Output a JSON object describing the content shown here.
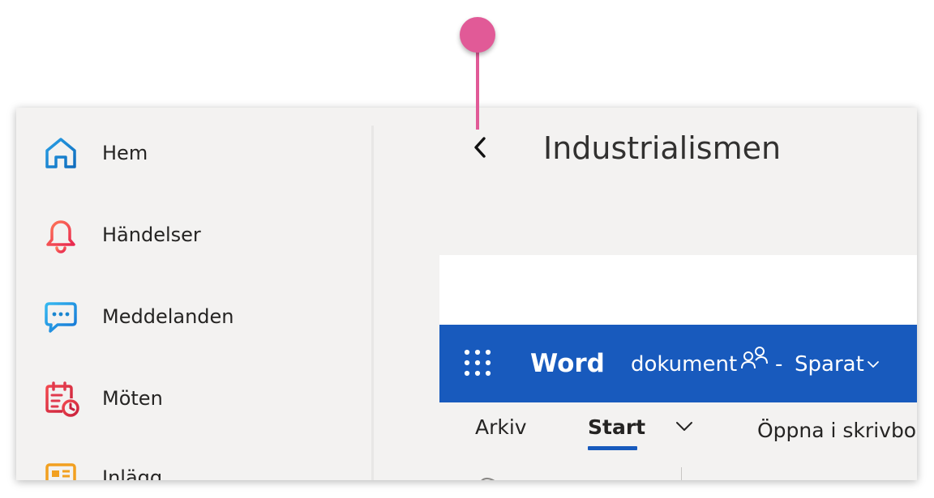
{
  "sidebar": {
    "items": [
      {
        "label": "Hem",
        "icon": "home-icon",
        "color": "#1a86d0"
      },
      {
        "label": "Händelser",
        "icon": "bell-icon",
        "color": "#f2484e"
      },
      {
        "label": "Meddelanden",
        "icon": "chat-icon",
        "color": "#1c9be6"
      },
      {
        "label": "Möten",
        "icon": "calendar-clock-icon",
        "color": "#e03a4e"
      },
      {
        "label": "Inlägg",
        "icon": "news-icon",
        "color": "#f2a020"
      }
    ]
  },
  "header": {
    "back_icon": "chevron-left-icon",
    "title": "Industrialismen"
  },
  "word": {
    "bar_color": "#185abd",
    "app_name": "Word",
    "doc_name": "dokument",
    "share_icon": "people-icon",
    "separator": "-",
    "save_status": "Sparat",
    "save_chevron_icon": "chevron-down-icon"
  },
  "ribbon": {
    "tabs": [
      {
        "label": "Arkiv",
        "active": false
      },
      {
        "label": "Start",
        "active": true
      },
      {
        "label": "Öppna i skrivbo",
        "active": false
      }
    ],
    "more_icon": "chevron-down-icon"
  },
  "annotation": {
    "marker_color": "#e15a97"
  }
}
